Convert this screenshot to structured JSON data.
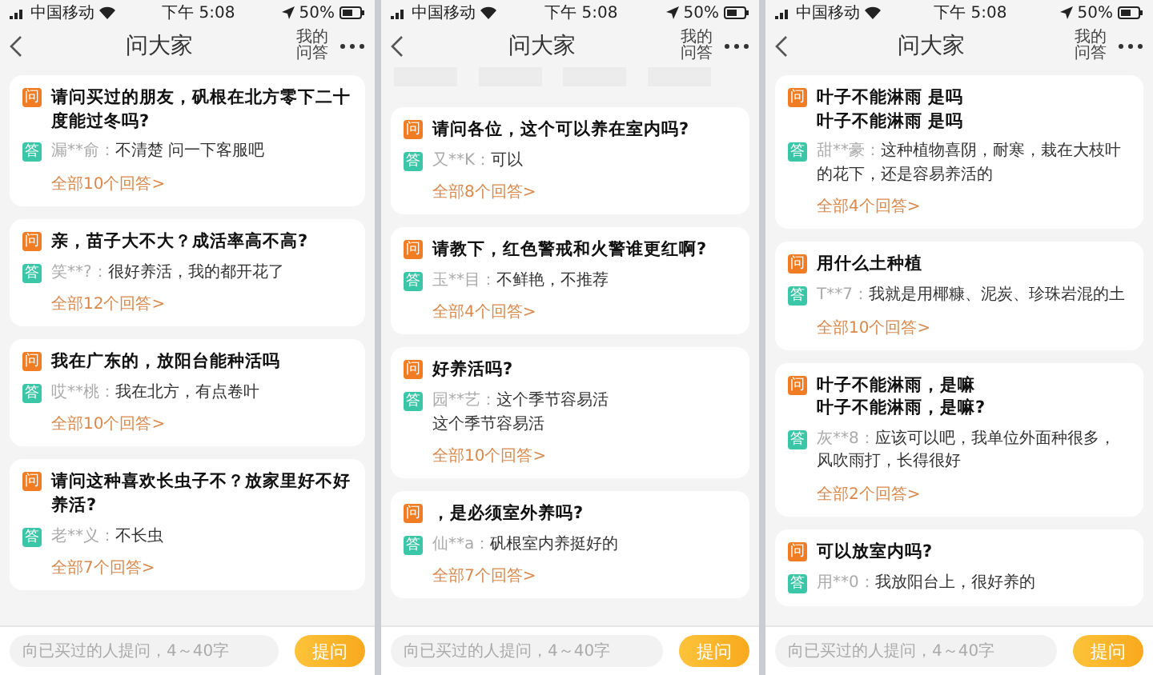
{
  "phones": [
    {
      "status_bar": {
        "carrier": "中国移动",
        "time": "下午 5:08",
        "battery": "50%"
      },
      "nav": {
        "title": "问大家",
        "my_qa": "我的问答"
      },
      "questions": [
        {
          "q_badge": "问",
          "question_lines": [
            "请问买过的朋友，矾根在北方零下二十度能过冬吗?"
          ],
          "a_badge": "答",
          "user": "漏**俞：",
          "answer_lines": [
            "不清楚 问一下客服吧"
          ],
          "more_link": "全部10个回答>"
        },
        {
          "q_badge": "问",
          "question_lines": [
            "亲，苗子大不大？成活率高不高?"
          ],
          "a_badge": "答",
          "user": "笑**?：",
          "answer_lines": [
            "很好养活，我的都开花了"
          ],
          "more_link": "全部12个回答>"
        },
        {
          "q_badge": "问",
          "question_lines": [
            "我在广东的，放阳台能种活吗"
          ],
          "a_badge": "答",
          "user": "哎**桃：",
          "answer_lines": [
            "我在北方，有点卷叶"
          ],
          "more_link": "全部10个回答>"
        },
        {
          "q_badge": "问",
          "question_lines": [
            "请问这种喜欢长虫子不？放家里好不好养活?"
          ],
          "a_badge": "答",
          "user": "老**义：",
          "answer_lines": [
            "不长虫"
          ],
          "more_link": "全部7个回答>"
        }
      ],
      "ask_bar": {
        "placeholder": "向已买过的人提问，4～40字",
        "button": "提问"
      }
    },
    {
      "status_bar": {
        "carrier": "中国移动",
        "time": "下午 5:08",
        "battery": "50%"
      },
      "nav": {
        "title": "问大家",
        "my_qa": "我的问答"
      },
      "tags_strip": true,
      "questions": [
        {
          "q_badge": "问",
          "question_lines": [
            "请问各位，这个可以养在室内吗?"
          ],
          "a_badge": "答",
          "user": "又**K：",
          "answer_lines": [
            "可以"
          ],
          "more_link": "全部8个回答>"
        },
        {
          "q_badge": "问",
          "question_lines": [
            "请教下，红色警戒和火警谁更红啊?"
          ],
          "a_badge": "答",
          "user": "玉**目：",
          "answer_lines": [
            "不鲜艳，不推荐"
          ],
          "more_link": "全部4个回答>"
        },
        {
          "q_badge": "问",
          "question_lines": [
            "好养活吗?"
          ],
          "a_badge": "答",
          "user": "园**艺：",
          "answer_lines": [
            "这个季节容易活",
            "这个季节容易活"
          ],
          "more_link": "全部10个回答>"
        },
        {
          "q_badge": "问",
          "question_lines": [
            "，是必须室外养吗?"
          ],
          "a_badge": "答",
          "user": "仙**a：",
          "answer_lines": [
            "矾根室内养挺好的"
          ],
          "more_link": "全部7个回答>"
        }
      ],
      "ask_bar": {
        "placeholder": "向已买过的人提问，4～40字",
        "button": "提问"
      }
    },
    {
      "status_bar": {
        "carrier": "中国移动",
        "time": "下午 5:08",
        "battery": "50%"
      },
      "nav": {
        "title": "问大家",
        "my_qa": "我的问答"
      },
      "questions": [
        {
          "q_badge": "问",
          "question_lines": [
            "叶子不能淋雨 是吗",
            "叶子不能淋雨 是吗"
          ],
          "a_badge": "答",
          "user": "甜**豪：",
          "answer_lines": [
            "这种植物喜阴，耐寒，栽在大枝叶的花下，还是容易养活的"
          ],
          "more_link": "全部4个回答>"
        },
        {
          "q_badge": "问",
          "question_lines": [
            "用什么土种植"
          ],
          "a_badge": "答",
          "user": "T**7：",
          "answer_lines": [
            "我就是用椰糠、泥炭、珍珠岩混的土"
          ],
          "more_link": "全部10个回答>"
        },
        {
          "q_badge": "问",
          "question_lines": [
            "叶子不能淋雨，是嘛",
            "叶子不能淋雨，是嘛?"
          ],
          "a_badge": "答",
          "user": "灰**8：",
          "answer_lines": [
            "应该可以吧，我单位外面种很多，风吹雨打，长得很好"
          ],
          "more_link": "全部2个回答>"
        },
        {
          "q_badge": "问",
          "question_lines": [
            "可以放室内吗?"
          ],
          "a_badge": "答",
          "user": "用**0：",
          "answer_lines": [
            "我放阳台上，很好养的"
          ]
        }
      ],
      "ask_bar": {
        "placeholder": "向已买过的人提问，4～40字",
        "button": "提问"
      }
    }
  ]
}
